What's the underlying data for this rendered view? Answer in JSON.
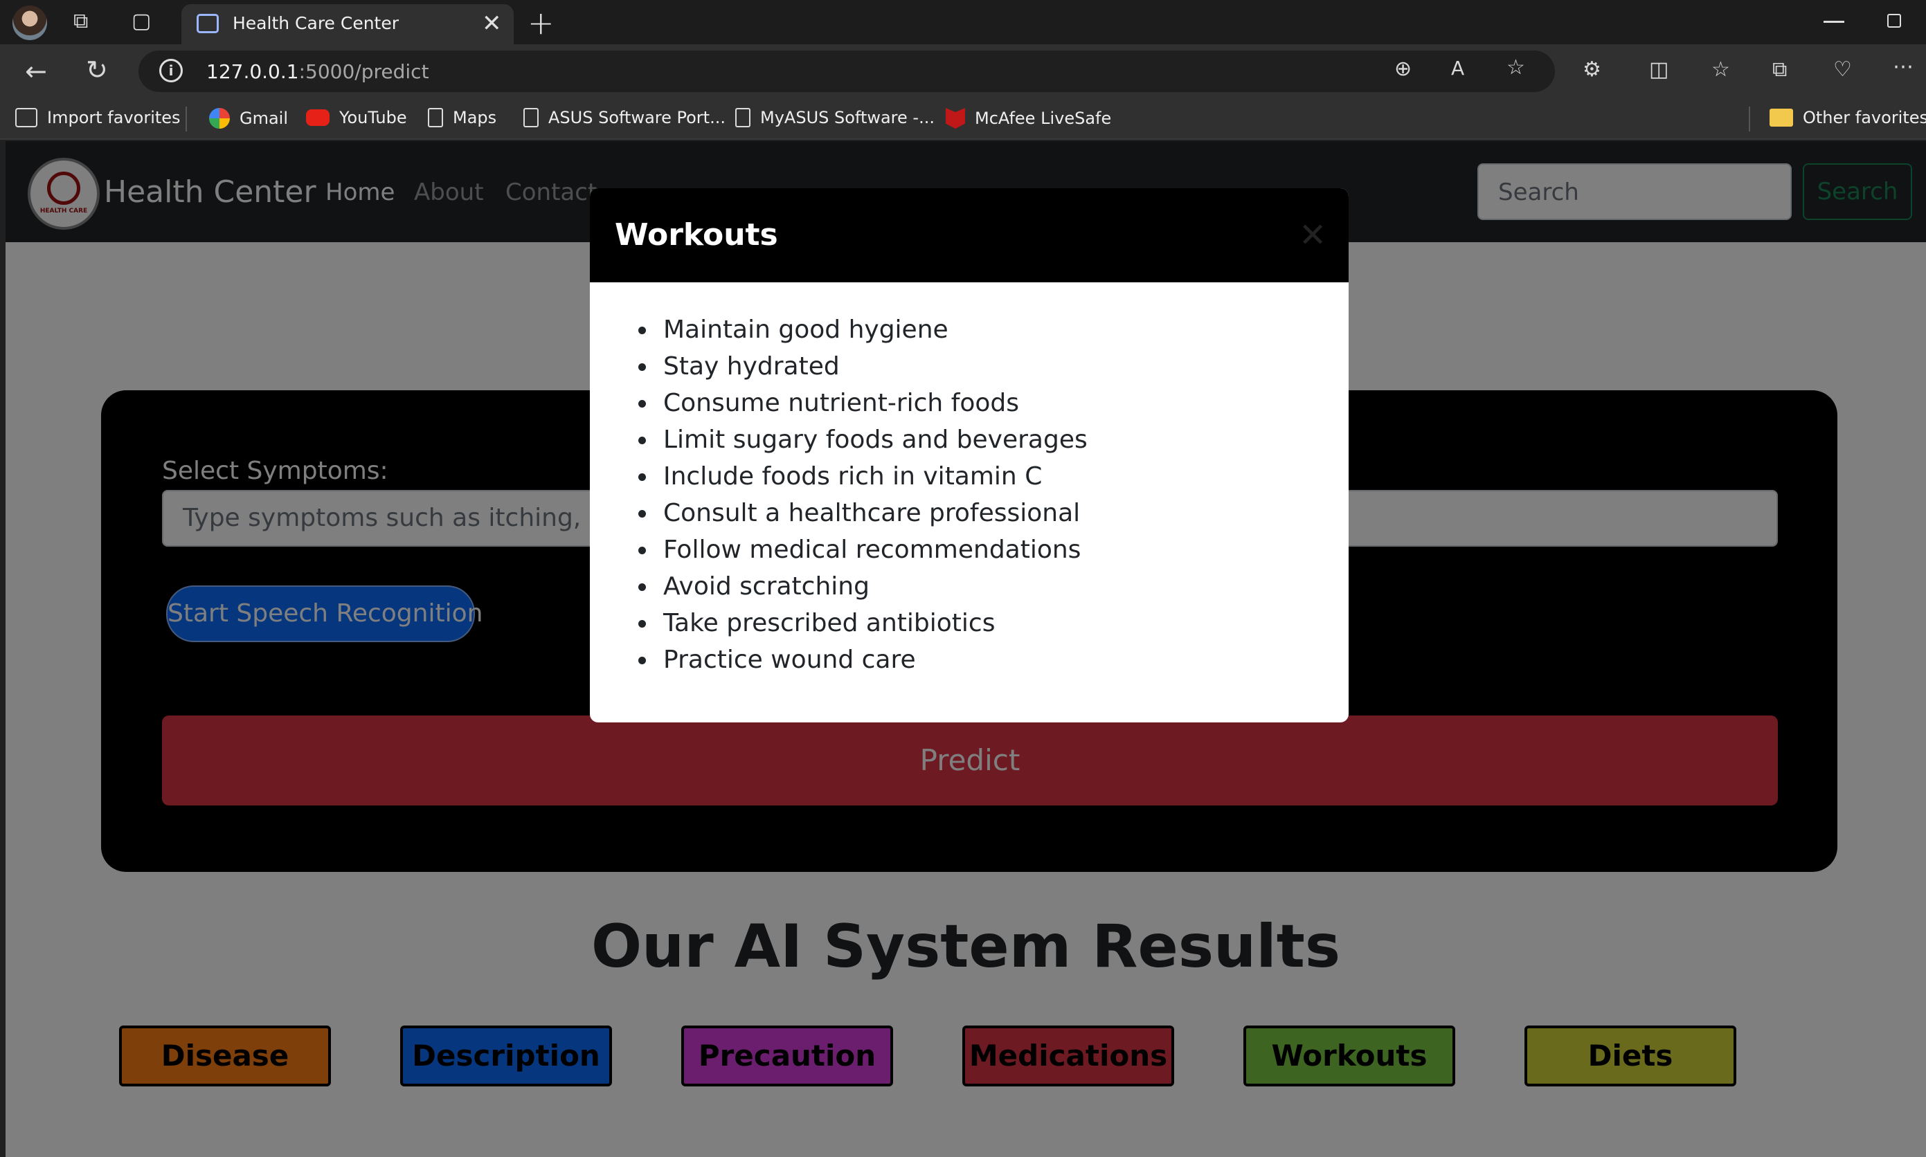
{
  "browser": {
    "tab_title": "Health Care Center",
    "url_host": "127.0.0.1",
    "url_path": ":5000/predict",
    "bookmarks": [
      {
        "label": "Import favorites",
        "icon": "import-icon"
      },
      {
        "label": "Gmail",
        "icon": "google-icon"
      },
      {
        "label": "YouTube",
        "icon": "youtube-icon"
      },
      {
        "label": "Maps",
        "icon": "page-icon"
      },
      {
        "label": "ASUS Software Port...",
        "icon": "page-icon"
      },
      {
        "label": "MyASUS Software -...",
        "icon": "page-icon"
      },
      {
        "label": "McAfee LiveSafe",
        "icon": "mcafee-icon"
      }
    ],
    "other_favorites": "Other favorites"
  },
  "navbar": {
    "brand": "Health Center",
    "logo_text": "HEALTH CARE",
    "links": [
      "Home",
      "About",
      "Contact"
    ],
    "search_placeholder": "Search",
    "search_button": "Search"
  },
  "form": {
    "label": "Select Symptoms:",
    "input_placeholder": "Type symptoms such as itching, sleepi",
    "speech_button": "Start Speech Recognition",
    "predict_button": "Predict"
  },
  "results": {
    "title": "Our AI System Results",
    "buttons": [
      {
        "label": "Disease",
        "color": "#fd7e14"
      },
      {
        "label": "Description",
        "color": "#0d6efd"
      },
      {
        "label": "Precaution",
        "color": "#d63dda"
      },
      {
        "label": "Medications",
        "color": "#dc3545"
      },
      {
        "label": "Workouts",
        "color": "#7ac943"
      },
      {
        "label": "Diets",
        "color": "#d4d43b"
      }
    ]
  },
  "modal": {
    "title": "Workouts",
    "items": [
      "Maintain good hygiene",
      "Stay hydrated",
      "Consume nutrient-rich foods",
      "Limit sugary foods and beverages",
      "Include foods rich in vitamin C",
      "Consult a healthcare professional",
      "Follow medical recommendations",
      "Avoid scratching",
      "Take prescribed antibiotics",
      "Practice wound care"
    ]
  }
}
